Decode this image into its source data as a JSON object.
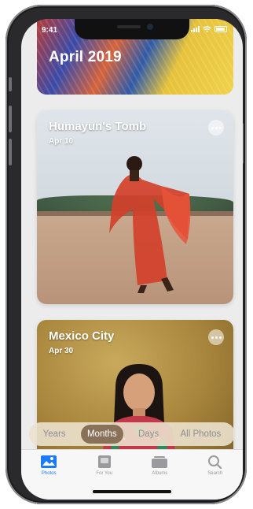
{
  "status_bar": {
    "time": "9:41"
  },
  "header": {
    "title": "April 2019"
  },
  "cards": [
    {
      "title": "Humayun's Tomb",
      "date": "Apr 10"
    },
    {
      "title": "Mexico City",
      "date": "Apr 30"
    }
  ],
  "segments": {
    "items": [
      "Years",
      "Months",
      "Days",
      "All Photos"
    ],
    "selected": "Months"
  },
  "tabs": [
    {
      "label": "Photos",
      "icon": "photos-icon",
      "active": true
    },
    {
      "label": "For You",
      "icon": "for-you-icon",
      "active": false
    },
    {
      "label": "Albums",
      "icon": "albums-icon",
      "active": false
    },
    {
      "label": "Search",
      "icon": "search-icon",
      "active": false
    }
  ],
  "colors": {
    "accent": "#1a7af8",
    "segment_active": "#785f46"
  }
}
